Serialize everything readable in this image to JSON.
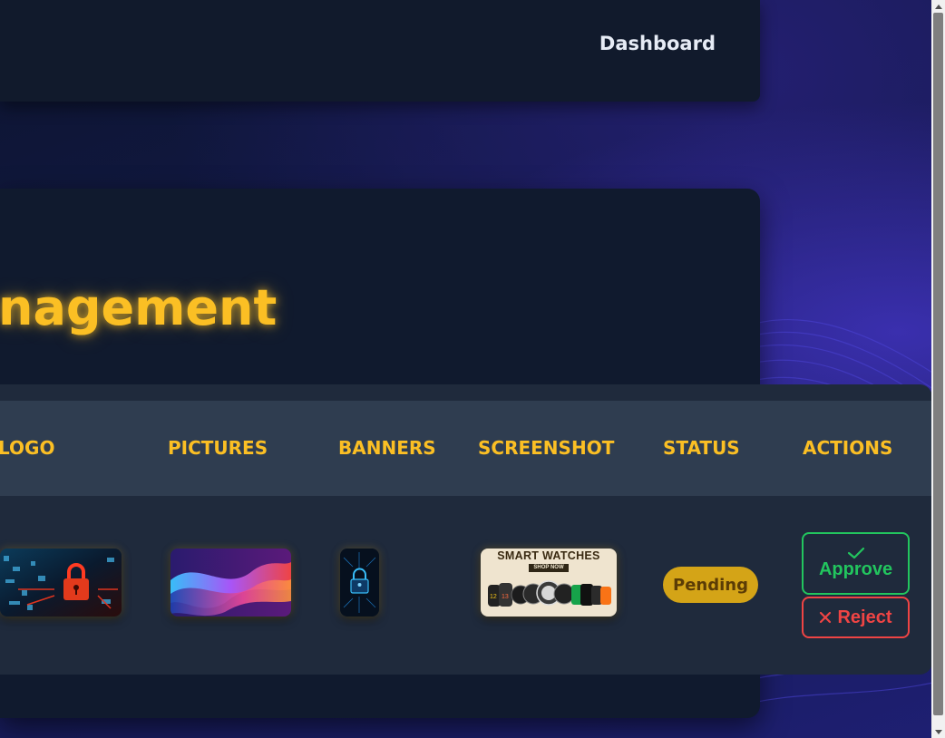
{
  "nav": {
    "dashboard_label": "Dashboard"
  },
  "page": {
    "title": "nagement"
  },
  "table": {
    "headers": {
      "logo": "LOGO",
      "pictures": "PICTURES",
      "banners": "BANNERS",
      "screenshot": "SCREENSHOT",
      "status": "STATUS",
      "actions": "ACTIONS"
    },
    "row": {
      "status": "Pending",
      "screenshot_heading": "SMART WATCHES",
      "screenshot_cta": "SHOP NOW",
      "approve_label": "Approve",
      "reject_label": "Reject",
      "watch_numbers": [
        "12",
        "13"
      ]
    }
  },
  "colors": {
    "accent": "#fbbf24",
    "approve": "#22c55e",
    "reject": "#ef4444",
    "pending_badge": "#d4a417"
  },
  "icons": {
    "approve": "check-icon",
    "reject": "x-icon",
    "logo_thumb": "padlock-icon",
    "banner_thumb": "lock-circuit-icon"
  }
}
